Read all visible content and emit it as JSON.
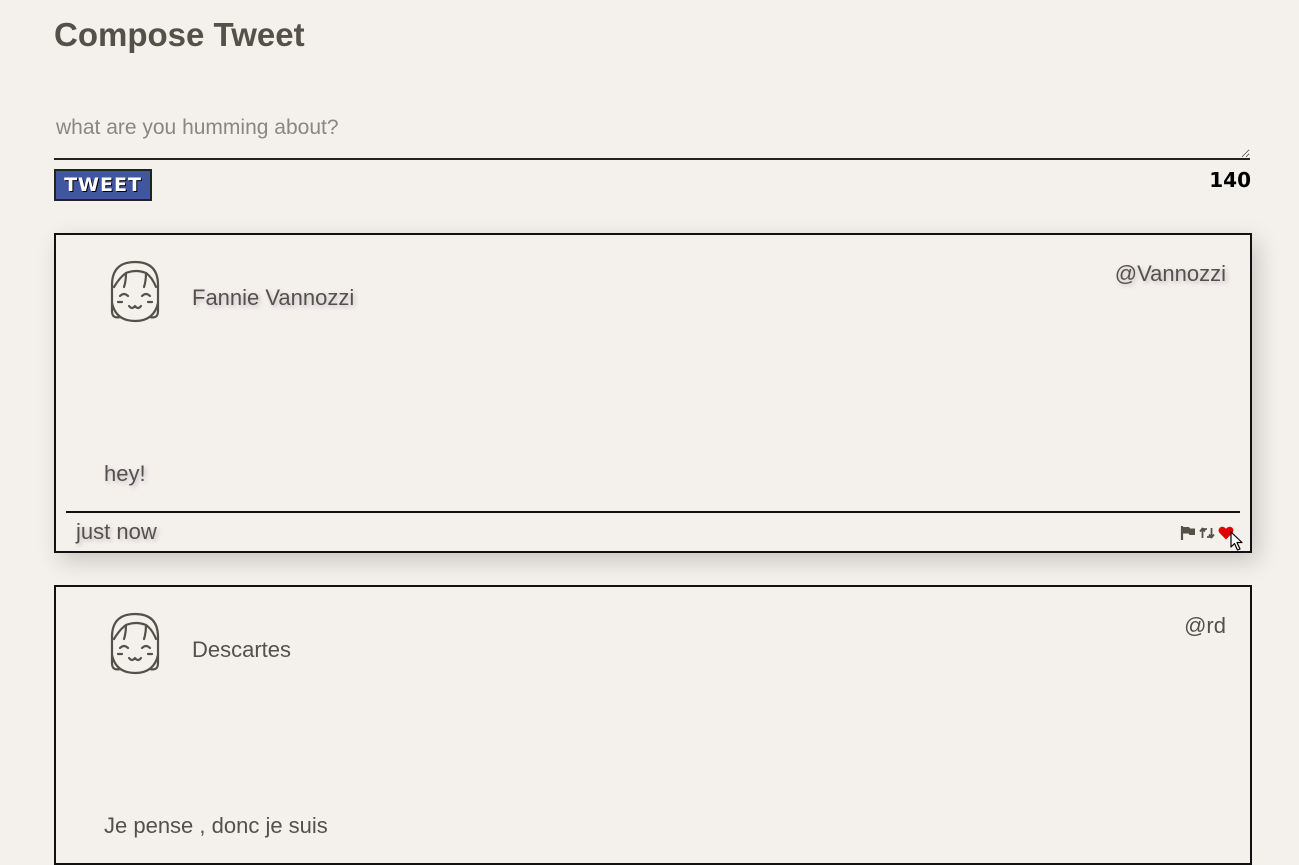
{
  "compose": {
    "title": "Compose Tweet",
    "placeholder": "what are you humming about?",
    "tweet_button_label": "TWEET",
    "char_counter": "140"
  },
  "tweets": [
    {
      "name": "Fannie Vannozzi",
      "handle": "@Vannozzi",
      "text": "hey!",
      "timestamp": "just now",
      "avatar_icon": "smiling-girl-avatar-icon",
      "actions": [
        "flag-icon",
        "retweet-icon",
        "heart-icon"
      ]
    },
    {
      "name": "Descartes",
      "handle": "@rd",
      "text": "Je pense , donc je suis",
      "avatar_icon": "smiling-girl-avatar-icon"
    }
  ],
  "colors": {
    "background": "#f4f1ec",
    "text": "#545149",
    "button": "#4056a1",
    "heart": "#e00000"
  }
}
